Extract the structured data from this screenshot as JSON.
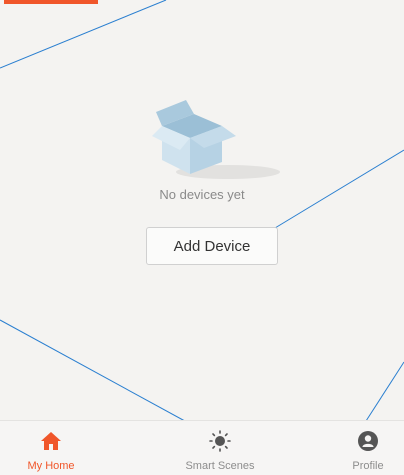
{
  "colors": {
    "accent": "#f0562a",
    "background": "#f4f3f1",
    "text_muted": "#8a8a8a",
    "nav_inactive": "#8d8d8d"
  },
  "main": {
    "empty_state": {
      "icon": "empty-box-icon",
      "message": "No devices yet"
    },
    "add_device_label": "Add Device"
  },
  "bottom_nav": {
    "items": [
      {
        "label": "My Home",
        "icon": "home-icon",
        "active": true
      },
      {
        "label": "Smart Scenes",
        "icon": "sun-icon",
        "active": false
      },
      {
        "label": "Profile",
        "icon": "profile-icon",
        "active": false
      }
    ]
  }
}
